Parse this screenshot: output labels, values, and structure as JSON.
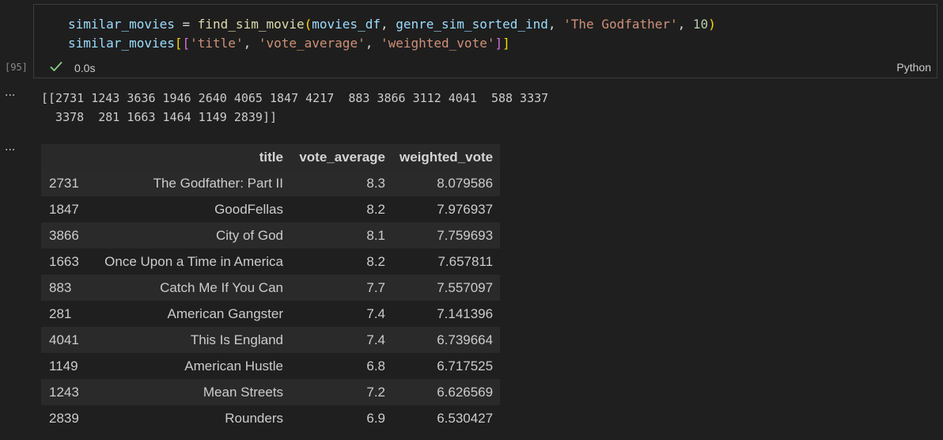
{
  "cell": {
    "execution_count": "[95]",
    "code": {
      "line1": {
        "var": "similar_movies",
        "eq": " = ",
        "fn": "find_sim_movie",
        "open": "(",
        "arg1": "movies_df",
        "comma1": ", ",
        "arg2": "genre_sim_sorted_ind",
        "comma2": ", ",
        "arg3": "'The Godfather'",
        "comma3": ", ",
        "arg4": "10",
        "close": ")"
      },
      "line2": {
        "var": "similar_movies",
        "open1": "[",
        "open2": "[",
        "s1": "'title'",
        "c1": ", ",
        "s2": "'vote_average'",
        "c2": ", ",
        "s3": "'weighted_vote'",
        "close2": "]",
        "close1": "]"
      }
    },
    "status_icon": "check-icon",
    "status_color": "#89d185",
    "duration": "0.0s",
    "language": "Python"
  },
  "outputs": {
    "menu_glyph": "···",
    "stream_text": "[[2731 1243 3636 1946 2640 4065 1847 4217  883 3866 3112 4041  588 3337\n  3378  281 1663 1464 1149 2839]]",
    "dataframe": {
      "columns": [
        "",
        "title",
        "vote_average",
        "weighted_vote"
      ],
      "rows": [
        {
          "index": "2731",
          "title": "The Godfather: Part II",
          "vote_average": "8.3",
          "weighted_vote": "8.079586"
        },
        {
          "index": "1847",
          "title": "GoodFellas",
          "vote_average": "8.2",
          "weighted_vote": "7.976937"
        },
        {
          "index": "3866",
          "title": "City of God",
          "vote_average": "8.1",
          "weighted_vote": "7.759693"
        },
        {
          "index": "1663",
          "title": "Once Upon a Time in America",
          "vote_average": "8.2",
          "weighted_vote": "7.657811"
        },
        {
          "index": "883",
          "title": "Catch Me If You Can",
          "vote_average": "7.7",
          "weighted_vote": "7.557097"
        },
        {
          "index": "281",
          "title": "American Gangster",
          "vote_average": "7.4",
          "weighted_vote": "7.141396"
        },
        {
          "index": "4041",
          "title": "This Is England",
          "vote_average": "7.4",
          "weighted_vote": "6.739664"
        },
        {
          "index": "1149",
          "title": "American Hustle",
          "vote_average": "6.8",
          "weighted_vote": "6.717525"
        },
        {
          "index": "1243",
          "title": "Mean Streets",
          "vote_average": "7.2",
          "weighted_vote": "6.626569"
        },
        {
          "index": "2839",
          "title": "Rounders",
          "vote_average": "6.9",
          "weighted_vote": "6.530427"
        }
      ]
    }
  }
}
